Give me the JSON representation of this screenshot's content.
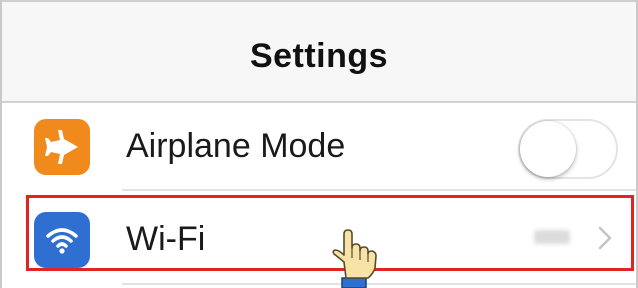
{
  "navigation": {
    "title": "Settings"
  },
  "settings_rows": [
    {
      "label": "Airplane Mode",
      "icon": "airplane-icon",
      "icon_color": "#f08a1c",
      "control": "toggle",
      "toggle_on": false
    },
    {
      "label": "Wi-Fi",
      "icon": "wifi-icon",
      "icon_color": "#2f6fd1",
      "control": "disclosure",
      "value_obscured": true,
      "highlighted": true
    }
  ],
  "annotation": {
    "highlight_color": "#e02424",
    "cursor": "hand-pointer-icon"
  }
}
